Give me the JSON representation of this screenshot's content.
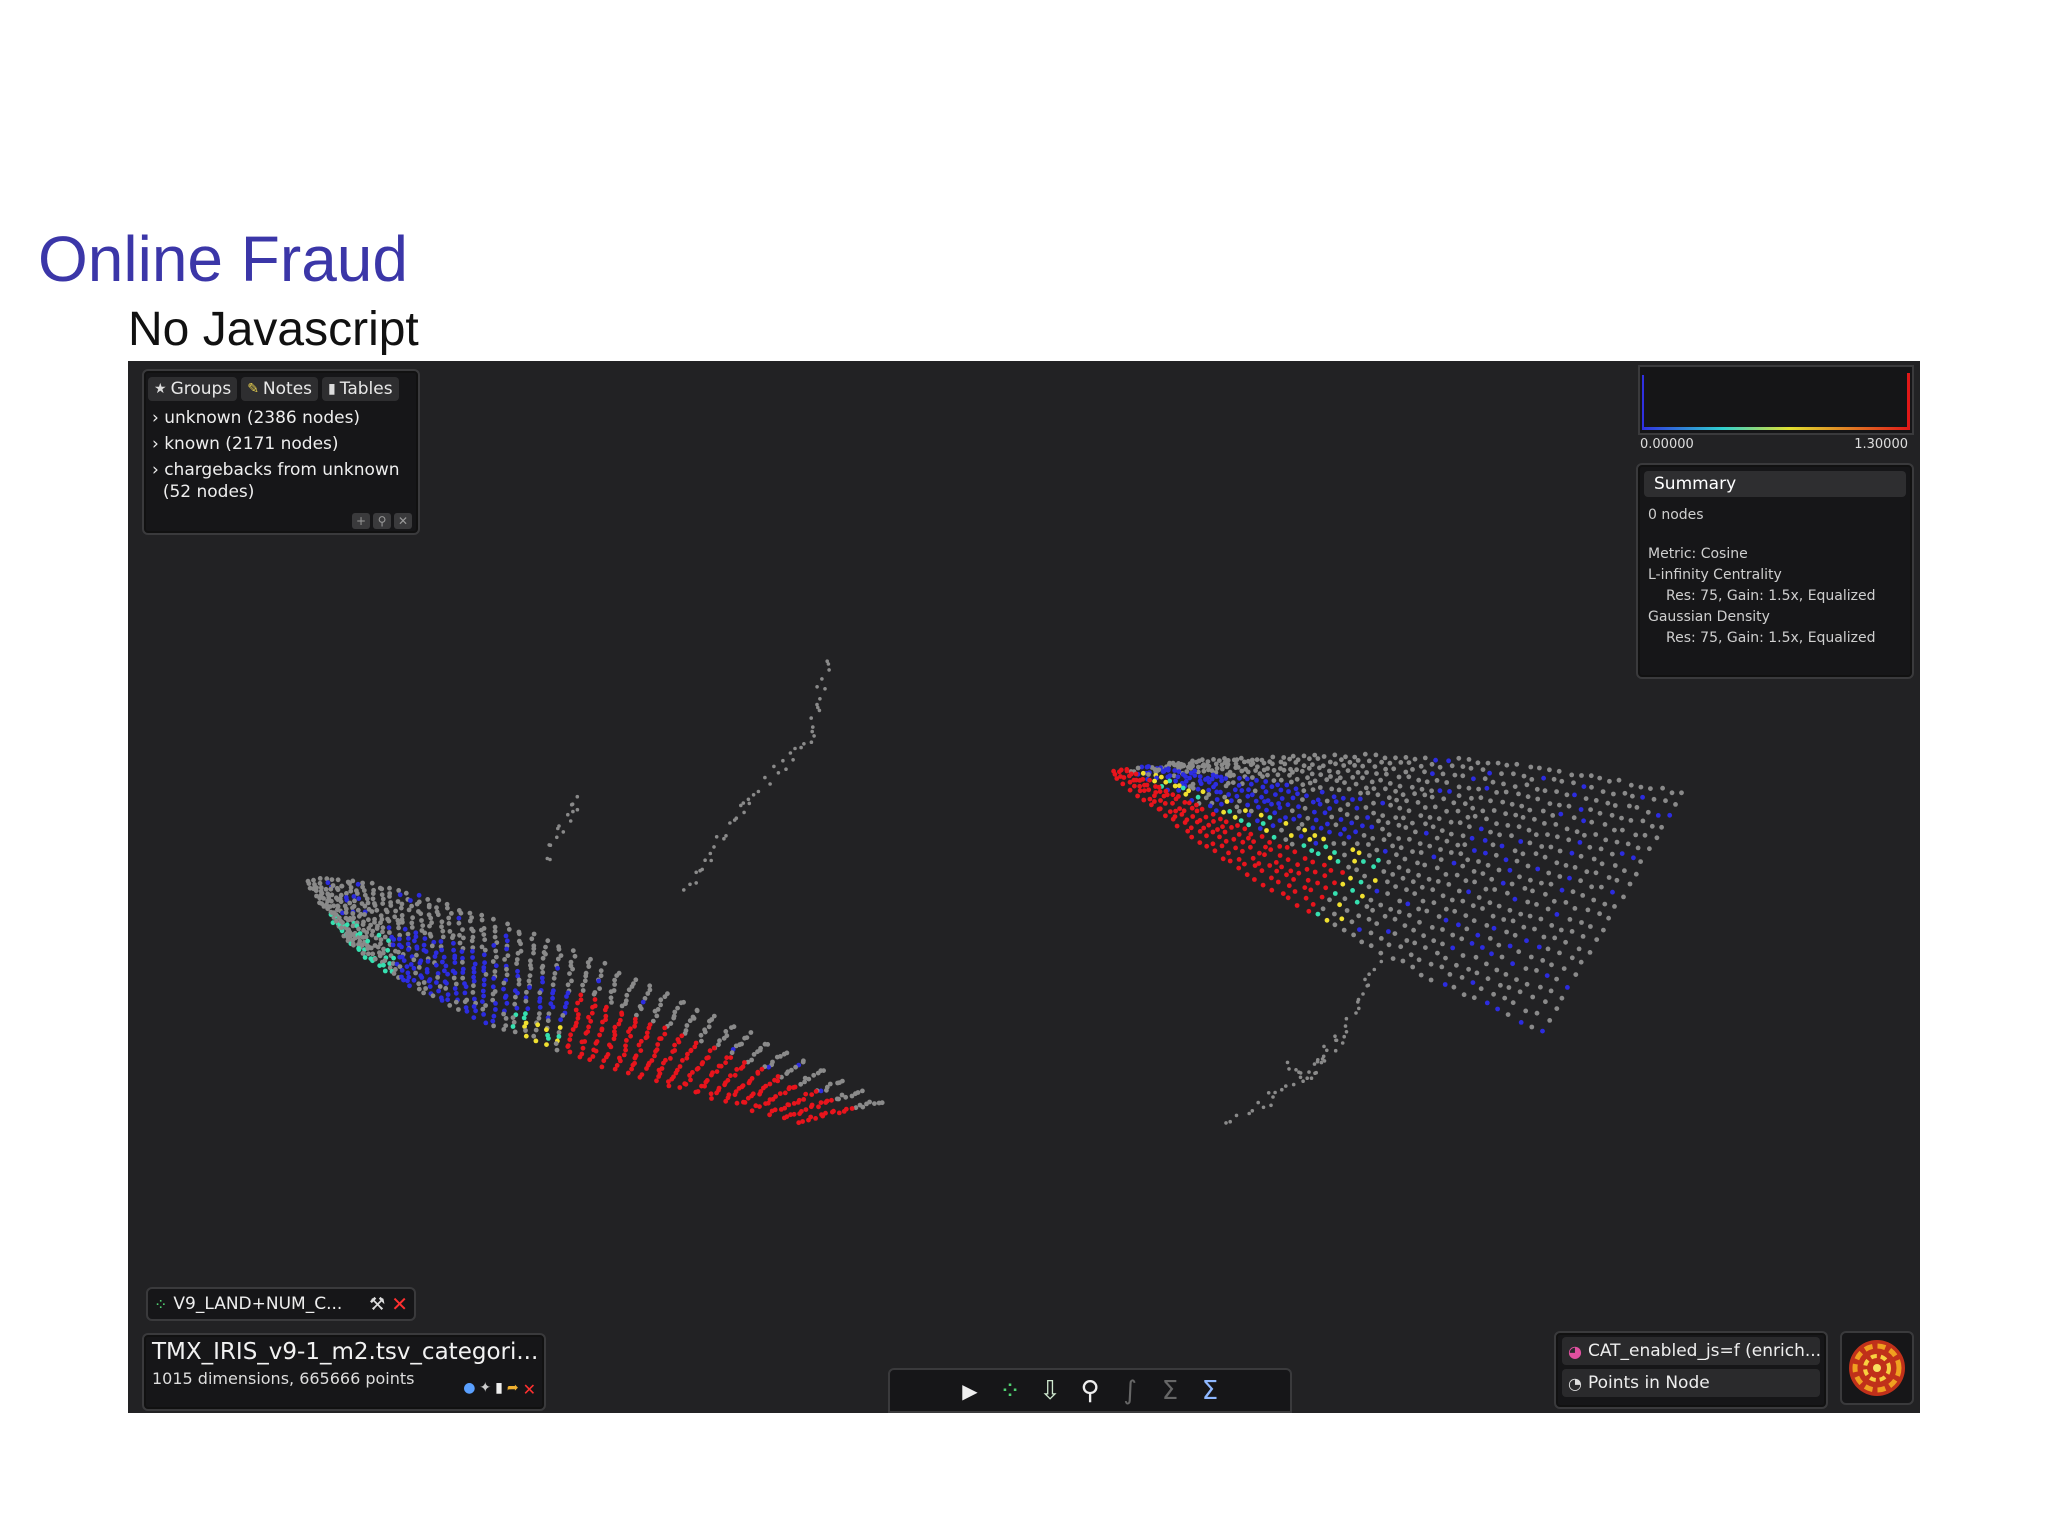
{
  "slide": {
    "title": "Online Fraud",
    "subtitle": "No Javascript"
  },
  "groups_panel": {
    "tabs": [
      {
        "icon": "star-icon",
        "label": "Groups"
      },
      {
        "icon": "note-icon",
        "label": "Notes"
      },
      {
        "icon": "document-icon",
        "label": "Tables"
      }
    ],
    "items": [
      {
        "label": "unknown (2386 nodes)"
      },
      {
        "label": "known (2171 nodes)"
      },
      {
        "label": "chargebacks from unknown",
        "label2": "(52 nodes)"
      }
    ]
  },
  "histogram": {
    "min": "0.00000",
    "max": "1.30000"
  },
  "summary": {
    "header": "Summary",
    "nodes": "0 nodes",
    "metric": "Metric: Cosine",
    "lens1": "L-infinity Centrality",
    "lens1_params": "Res: 75, Gain: 1.5x, Equalized",
    "lens2": "Gaussian Density",
    "lens2_params": "Res: 75, Gain: 1.5x, Equalized"
  },
  "coloring": {
    "label": "V9_LAND+NUM_C..."
  },
  "dataset": {
    "name": "TMX_IRIS_v9-1_m2.tsv_categori...",
    "info": "1015 dimensions, 665666 points"
  },
  "toolbar": {
    "tools": [
      "play-icon",
      "network-icon",
      "export-icon",
      "search-icon",
      "lasso-icon",
      "sigma-icon",
      "sigma-compare-icon"
    ]
  },
  "color_panel": {
    "variable": "CAT_enabled_js=f (enrich...",
    "mode": "Points in Node"
  },
  "colors": {
    "title": "#3b36a8",
    "background": "#222224",
    "high": "#e8141c",
    "low": "#2c2ce0",
    "mid": "#36e0b0",
    "warm": "#f0e030",
    "neutral": "#8a8a8a"
  }
}
